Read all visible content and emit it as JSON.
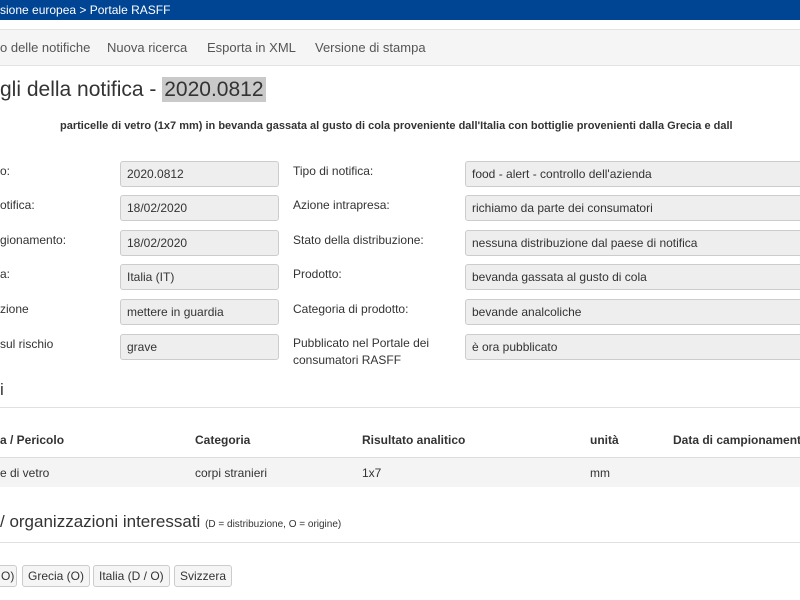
{
  "breadcrumb": {
    "part1": "sione europea",
    "sep": " > ",
    "part2": "Portale RASFF"
  },
  "nav": {
    "items": [
      "o delle notifiche",
      "Nuova ricerca",
      "Esporta in XML",
      "Versione di stampa"
    ]
  },
  "page": {
    "title_prefix": "gli della notifica - ",
    "title_ref": "2020.0812",
    "subject": "particelle di vetro (1x7 mm) in bevanda gassata al gusto di cola proveniente dall'Italia con bottiglie provenienti dalla Grecia e dall"
  },
  "details": {
    "left": [
      {
        "label": "o:",
        "value": "2020.0812"
      },
      {
        "label": "otifica:",
        "value": "18/02/2020"
      },
      {
        "label": "gionamento:",
        "value": "18/02/2020"
      },
      {
        "label": "a:",
        "value": "Italia (IT)"
      },
      {
        "label": "zione",
        "value": "mettere in guardia"
      },
      {
        "label": "sul rischio",
        "value": "grave"
      }
    ],
    "right": [
      {
        "label": "Tipo di notifica:",
        "value": "food - alert - controllo dell'azienda"
      },
      {
        "label": "Azione intrapresa:",
        "value": "richiamo da parte dei consumatori"
      },
      {
        "label": "Stato della distribuzione:",
        "value": "nessuna distribuzione dal paese di notifica"
      },
      {
        "label": "Prodotto:",
        "value": "bevanda gassata al gusto di cola"
      },
      {
        "label": "Categoria di prodotto:",
        "value": "bevande analcoliche"
      },
      {
        "label_line1": "Pubblicato nel Portale dei",
        "label_line2": "consumatori RASFF",
        "value": "è ora pubblicato"
      }
    ]
  },
  "hazards": {
    "heading": "i",
    "columns": [
      "a / Pericolo",
      "Categoria",
      "Risultato analitico",
      "unità",
      "Data di campionamento"
    ],
    "rows": [
      [
        "e di vetro",
        "corpi stranieri",
        "1x7",
        "mm",
        ""
      ]
    ]
  },
  "orgs": {
    "heading": "/ organizzazioni interessati",
    "note": "(D = distribuzione, O = origine)",
    "countries": [
      "O)",
      "Grecia (O)",
      "Italia (D / O)",
      "Svizzera"
    ]
  }
}
